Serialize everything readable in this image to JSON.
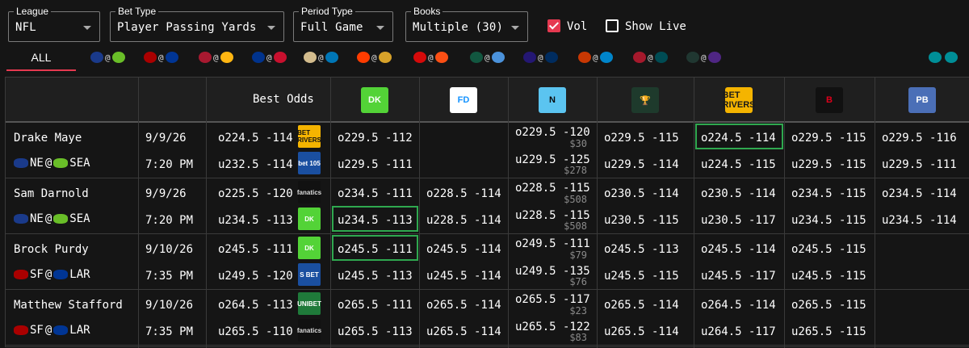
{
  "filters": {
    "league": {
      "label": "League",
      "value": "NFL"
    },
    "bet_type": {
      "label": "Bet Type",
      "value": "Player Passing Yards"
    },
    "period": {
      "label": "Period Type",
      "value": "Full Game"
    },
    "books": {
      "label": "Books",
      "value": "Multiple (30)"
    },
    "vol": {
      "label": "Vol",
      "checked": true
    },
    "show_live": {
      "label": "Show Live",
      "checked": false
    }
  },
  "tabs": {
    "all_label": "ALL",
    "games": [
      {
        "away_color": "#1a3a8a",
        "home_color": "#69be28",
        "sep": "@"
      },
      {
        "away_color": "#aa0000",
        "home_color": "#003594",
        "sep": "@"
      },
      {
        "away_color": "#a71930",
        "home_color": "#ffb612",
        "sep": "@"
      },
      {
        "away_color": "#00338d",
        "home_color": "#c8102e",
        "sep": "@"
      },
      {
        "away_color": "#d3bc8d",
        "home_color": "#0076b6",
        "sep": "@"
      },
      {
        "away_color": "#ff3c00",
        "home_color": "#d7a22a",
        "sep": "@"
      },
      {
        "away_color": "#d50a0a",
        "home_color": "#fb4f14",
        "sep": "@"
      },
      {
        "away_color": "#125740",
        "home_color": "#4b92db",
        "sep": "@"
      },
      {
        "away_color": "#241773",
        "home_color": "#002c5f",
        "sep": "@"
      },
      {
        "away_color": "#c83803",
        "home_color": "#0085ca",
        "sep": "@"
      },
      {
        "away_color": "#a5192c",
        "home_color": "#004c54",
        "sep": "@"
      },
      {
        "away_color": "#203731",
        "home_color": "#4f2683",
        "sep": "@"
      },
      {
        "away_color": "#008e97",
        "home_color": "#008e97",
        "sep": ""
      }
    ]
  },
  "header": {
    "best_odds": "Best Odds",
    "books": [
      {
        "name": "draftkings",
        "bg": "#53d337",
        "fg": "#fff",
        "text": "DK"
      },
      {
        "name": "fanduel",
        "bg": "#ffffff",
        "fg": "#1493ff",
        "text": "FD"
      },
      {
        "name": "novig",
        "bg": "#5bc4f0",
        "fg": "#0a0a0a",
        "text": "N"
      },
      {
        "name": "circa",
        "bg": "#1e3a2c",
        "fg": "#d8c68a",
        "text": "🏆"
      },
      {
        "name": "betrivers",
        "bg": "#f5b400",
        "fg": "#1a1a1a",
        "text": "BET RIVERS"
      },
      {
        "name": "bovada",
        "bg": "#111111",
        "fg": "#e0001b",
        "text": "B"
      },
      {
        "name": "props-builder",
        "bg": "#4b6fb7",
        "fg": "#fff",
        "text": "PB"
      }
    ]
  },
  "rows": [
    {
      "player": "Drake Maye",
      "date": "9/9/26",
      "time": "7:20 PM",
      "away": "NE",
      "home": "SEA",
      "away_color": "#1a3a8a",
      "home_color": "#69be28",
      "best_over": "o224.5 -114",
      "best_under": "u232.5 -114",
      "best_over_book": {
        "bg": "#f5b400",
        "fg": "#111",
        "text": "BET RIVERS"
      },
      "best_under_book": {
        "bg": "#1a4fa0",
        "fg": "#fff",
        "text": "bet 105"
      },
      "books": [
        {
          "over": "o229.5 -112",
          "under": "u229.5 -111"
        },
        {
          "over": "",
          "under": ""
        },
        {
          "over": "o229.5 -120",
          "over_sub": "$30",
          "under": "u229.5 -125",
          "under_sub": "$278"
        },
        {
          "over": "o229.5 -115",
          "under": "u229.5 -114"
        },
        {
          "over": "o224.5 -114",
          "under": "u224.5 -115"
        },
        {
          "over": "o229.5 -115",
          "under": "u229.5 -115"
        },
        {
          "over": "o229.5 -116",
          "under": "u229.5 -111"
        }
      ]
    },
    {
      "player": "Sam Darnold",
      "date": "9/9/26",
      "time": "7:20 PM",
      "away": "NE",
      "home": "SEA",
      "away_color": "#1a3a8a",
      "home_color": "#69be28",
      "best_over": "o225.5 -120",
      "best_under": "u234.5 -113",
      "best_over_book": {
        "bg": "#111",
        "fg": "#ddd",
        "text": "fanatics"
      },
      "best_under_book": {
        "bg": "#53d337",
        "fg": "#fff",
        "text": "DK"
      },
      "books": [
        {
          "over": "o234.5 -111",
          "under": "u234.5 -113"
        },
        {
          "over": "o228.5 -114",
          "under": "u228.5 -114"
        },
        {
          "over": "o228.5 -115",
          "over_sub": "$508",
          "under": "u228.5 -115",
          "under_sub": "$508"
        },
        {
          "over": "o230.5 -114",
          "under": "u230.5 -115"
        },
        {
          "over": "o230.5 -114",
          "under": "u230.5 -117"
        },
        {
          "over": "o234.5 -115",
          "under": "u234.5 -115"
        },
        {
          "over": "o234.5 -114",
          "under": "u234.5 -114"
        }
      ]
    },
    {
      "player": "Brock Purdy",
      "date": "9/10/26",
      "time": "7:35 PM",
      "away": "SF",
      "home": "LAR",
      "away_color": "#aa0000",
      "home_color": "#003594",
      "best_over": "o245.5 -111",
      "best_under": "u249.5 -120",
      "best_over_book": {
        "bg": "#53d337",
        "fg": "#fff",
        "text": "DK"
      },
      "best_under_book": {
        "bg": "#1a4fa0",
        "fg": "#fff",
        "text": "S BET"
      },
      "books": [
        {
          "over": "o245.5 -111",
          "under": "u245.5 -113"
        },
        {
          "over": "o245.5 -114",
          "under": "u245.5 -114"
        },
        {
          "over": "o249.5 -111",
          "over_sub": "$79",
          "under": "u249.5 -135",
          "under_sub": "$76"
        },
        {
          "over": "o245.5 -113",
          "under": "u245.5 -115"
        },
        {
          "over": "o245.5 -114",
          "under": "u245.5 -117"
        },
        {
          "over": "o245.5 -115",
          "under": "u245.5 -115"
        },
        {
          "over": "",
          "under": ""
        }
      ]
    },
    {
      "player": "Matthew Stafford",
      "date": "9/10/26",
      "time": "7:35 PM",
      "away": "SF",
      "home": "LAR",
      "away_color": "#aa0000",
      "home_color": "#003594",
      "best_over": "o264.5 -113",
      "best_under": "u265.5 -110",
      "best_over_book": {
        "bg": "#1f7a3a",
        "fg": "#fff",
        "text": "UNIBET"
      },
      "best_under_book": {
        "bg": "#111",
        "fg": "#ddd",
        "text": "fanatics"
      },
      "books": [
        {
          "over": "o265.5 -111",
          "under": "u265.5 -113"
        },
        {
          "over": "o265.5 -114",
          "under": "u265.5 -114"
        },
        {
          "over": "o265.5 -117",
          "over_sub": "$23",
          "under": "u265.5 -122",
          "under_sub": "$83"
        },
        {
          "over": "o265.5 -114",
          "under": "u265.5 -114"
        },
        {
          "over": "o264.5 -114",
          "under": "u264.5 -117"
        },
        {
          "over": "o265.5 -115",
          "under": "u265.5 -115"
        },
        {
          "over": "",
          "under": ""
        }
      ]
    }
  ]
}
